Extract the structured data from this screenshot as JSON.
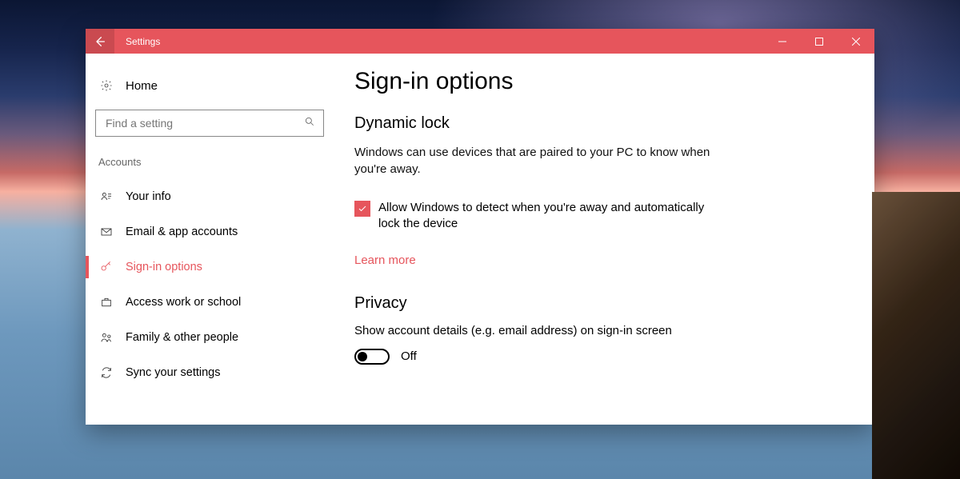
{
  "window": {
    "title": "Settings"
  },
  "sidebar": {
    "home": "Home",
    "search_placeholder": "Find a setting",
    "section": "Accounts",
    "items": [
      {
        "label": "Your info"
      },
      {
        "label": "Email & app accounts"
      },
      {
        "label": "Sign-in options"
      },
      {
        "label": "Access work or school"
      },
      {
        "label": "Family & other people"
      },
      {
        "label": "Sync your settings"
      }
    ],
    "active_index": 2
  },
  "content": {
    "title": "Sign-in options",
    "dynamic_lock": {
      "heading": "Dynamic lock",
      "desc": "Windows can use devices that are paired to your PC to know when you're away.",
      "checkbox_label": "Allow Windows to detect when you're away and automatically lock the device",
      "checkbox_checked": true,
      "learn_more": "Learn more"
    },
    "privacy": {
      "heading": "Privacy",
      "desc": "Show account details (e.g. email address) on sign-in screen",
      "toggle_state": "Off"
    }
  },
  "colors": {
    "accent": "#e6555c"
  }
}
